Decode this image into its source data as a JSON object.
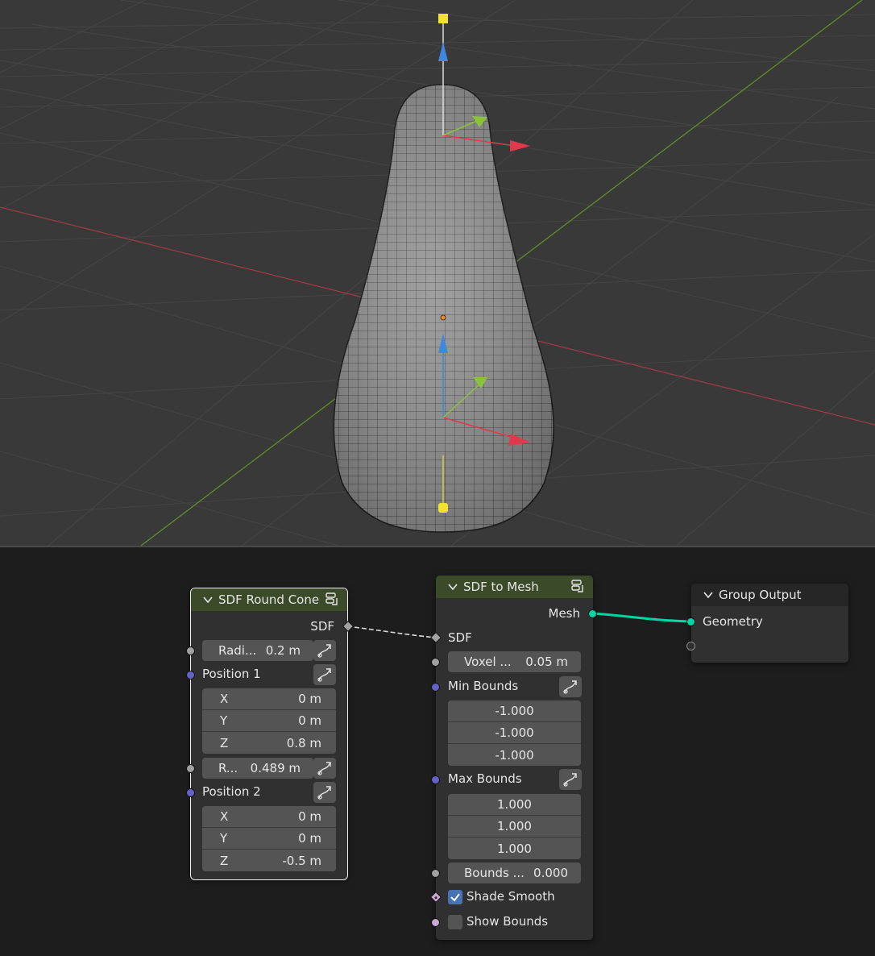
{
  "viewport": {
    "colors": {
      "background": "#393939",
      "x_axis": "#c43b4b",
      "y_axis": "#6a9a2a",
      "mesh": "#8e8e8e"
    }
  },
  "nodes": {
    "round_cone": {
      "title": "SDF Round Cone",
      "header_color": "#3b4b2a",
      "output_sdf": "SDF",
      "radius1": {
        "name": "Radi...",
        "value": "0.2 m"
      },
      "position1": {
        "label": "Position 1",
        "x": {
          "axis": "X",
          "value": "0 m"
        },
        "y": {
          "axis": "Y",
          "value": "0 m"
        },
        "z": {
          "axis": "Z",
          "value": "0.8 m"
        }
      },
      "radius2": {
        "name": "R...",
        "value": "0.489 m"
      },
      "position2": {
        "label": "Position 2",
        "x": {
          "axis": "X",
          "value": "0 m"
        },
        "y": {
          "axis": "Y",
          "value": "0 m"
        },
        "z": {
          "axis": "Z",
          "value": "-0.5 m"
        }
      }
    },
    "sdf_to_mesh": {
      "title": "SDF to Mesh",
      "header_color": "#3b4b2a",
      "output_mesh": "Mesh",
      "input_sdf": "SDF",
      "voxel": {
        "name": "Voxel ...",
        "value": "0.05 m"
      },
      "min_bounds": {
        "label": "Min Bounds",
        "values": [
          "-1.000",
          "-1.000",
          "-1.000"
        ]
      },
      "max_bounds": {
        "label": "Max Bounds",
        "values": [
          "1.000",
          "1.000",
          "1.000"
        ]
      },
      "bounds_pad": {
        "name": "Bounds ...",
        "value": "0.000"
      },
      "shade_smooth": {
        "label": "Shade Smooth",
        "checked": true
      },
      "show_bounds": {
        "label": "Show Bounds",
        "checked": false
      }
    },
    "group_output": {
      "title": "Group Output",
      "input_geometry": "Geometry"
    }
  },
  "link_colors": {
    "geometry": "#00d6a3",
    "sdf": "#d9d9d9"
  }
}
